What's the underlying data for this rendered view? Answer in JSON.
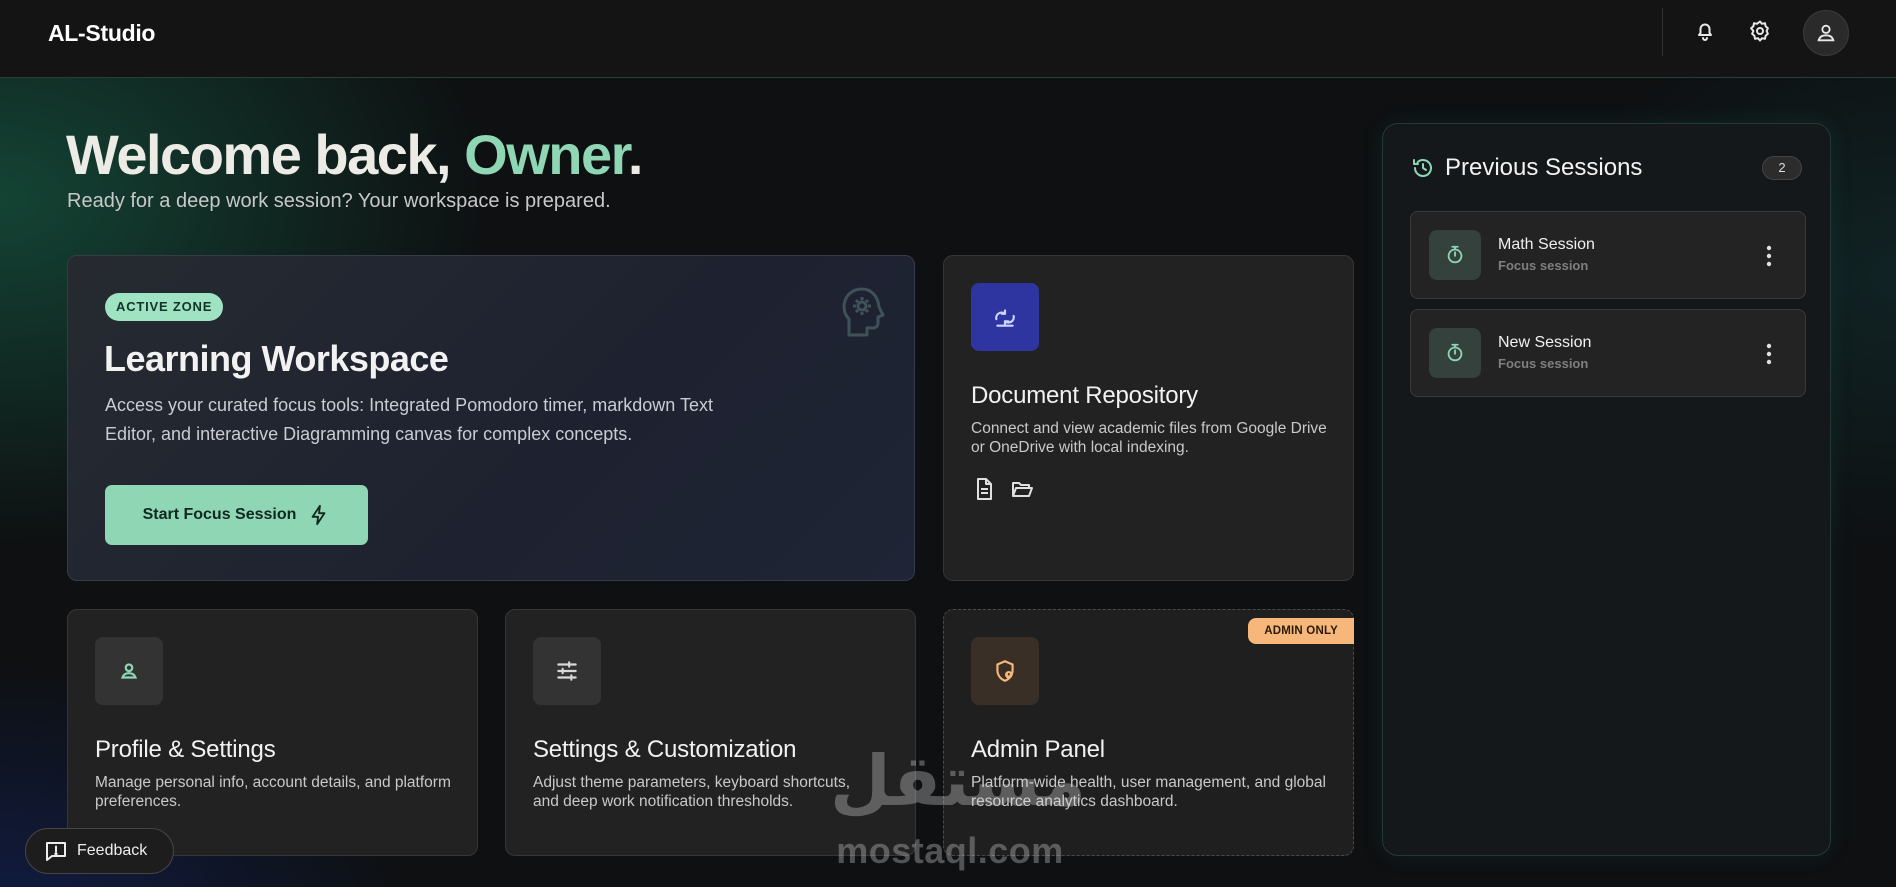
{
  "header": {
    "brand": "AL-Studio"
  },
  "welcome": {
    "prefix": "Welcome back, ",
    "name": "Owner",
    "suffix": ".",
    "subtitle": "Ready for a deep work session? Your workspace is prepared."
  },
  "main_card": {
    "badge": "ACTIVE ZONE",
    "title": "Learning Workspace",
    "description": "Access your curated focus tools: Integrated Pomodoro timer, markdown Text Editor, and interactive Diagramming canvas for complex concepts.",
    "button_label": "Start Focus Session"
  },
  "doc_card": {
    "title": "Document Repository",
    "description": "Connect and view academic files from Google Drive or OneDrive with local indexing."
  },
  "profile_card": {
    "title": "Profile & Settings",
    "description": "Manage personal info, account details, and platform preferences."
  },
  "custom_card": {
    "title": "Settings & Customization",
    "description": "Adjust theme parameters, keyboard shortcuts, and deep work notification thresholds."
  },
  "admin_card": {
    "badge": "ADMIN ONLY",
    "title": "Admin Panel",
    "description": "Platform-wide health, user management, and global resource analytics dashboard."
  },
  "sessions": {
    "title": "Previous Sessions",
    "count": "2",
    "items": [
      {
        "name": "Math Session",
        "type": "Focus session"
      },
      {
        "name": "New Session",
        "type": "Focus session"
      }
    ]
  },
  "feedback": {
    "label": "Feedback"
  },
  "watermark": {
    "arabic": "مستقل",
    "latin": "mostaql.com"
  },
  "colors": {
    "accent": "#8fd6b4",
    "doc_tile": "#2e35a0",
    "admin_badge": "#f7b77a"
  }
}
